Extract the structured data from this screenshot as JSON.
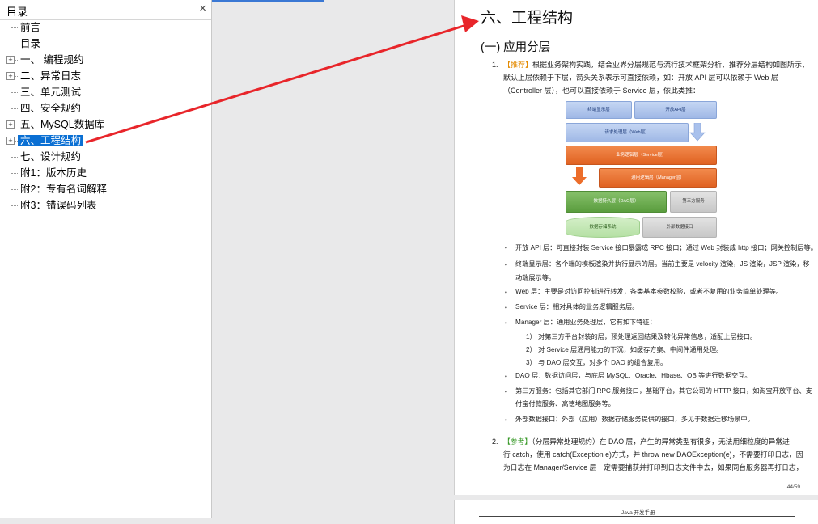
{
  "toc": {
    "title": "目录",
    "close": "×",
    "items": [
      {
        "label": "前言",
        "expandable": false,
        "selected": false
      },
      {
        "label": "目录",
        "expandable": false,
        "selected": false
      },
      {
        "label": "一、 编程规约",
        "expandable": true,
        "selected": false
      },
      {
        "label": "二、异常日志",
        "expandable": true,
        "selected": false
      },
      {
        "label": "三、单元测试",
        "expandable": false,
        "selected": false
      },
      {
        "label": "四、安全规约",
        "expandable": false,
        "selected": false
      },
      {
        "label": "五、MySQL数据库",
        "expandable": true,
        "selected": false
      },
      {
        "label": "六、工程结构",
        "expandable": true,
        "selected": true
      },
      {
        "label": "七、设计规约",
        "expandable": false,
        "selected": false
      },
      {
        "label": "附1：版本历史",
        "expandable": false,
        "selected": false
      },
      {
        "label": "附2：专有名词解释",
        "expandable": false,
        "selected": false
      },
      {
        "label": "附3：错误码列表",
        "expandable": false,
        "selected": false
      }
    ]
  },
  "doc": {
    "chapter_title": "六、工程结构",
    "section_title": "(一) 应用分层",
    "item1": {
      "num": "1.",
      "tag": "【推荐】",
      "line1": "根据业务架构实践，结合业界分层规范与流行技术框架分析，推荐分层结构如图所示，",
      "line2": "默认上层依赖于下层，箭头关系表示可直接依赖，如：开放 API 层可以依赖于 Web 层",
      "line3": "（Controller 层），也可以直接依赖于 Service 层，依此类推："
    },
    "diagram": {
      "terminal": "终端显示层",
      "open_api": "开放API层",
      "web": "请求处理层（Web层）",
      "service": "业务逻辑层（Service层）",
      "manager": "通用逻辑层（Manager层）",
      "dao": "数据持久层（DAO层）",
      "third_party": "第三方服务",
      "storage": "数据存储系统",
      "external": "外部数据接口"
    },
    "bullets": [
      "开放 API 层：可直接封装 Service 接口暴露成 RPC 接口；通过 Web 封装成 http 接口；网关控制层等。",
      "终端显示层：各个端的模板渲染并执行显示的层。当前主要是 velocity 渲染，JS 渲染，JSP 渲染，移",
      "动端展示等。",
      "Web 层：主要是对访问控制进行转发，各类基本参数校验，或者不复用的业务简单处理等。",
      "Service 层：相对具体的业务逻辑服务层。",
      "Manager 层：通用业务处理层，它有如下特征：",
      "1） 对第三方平台封装的层，预处理返回结果及转化异常信息，适配上层接口。",
      "2） 对 Service 层通用能力的下沉，如缓存方案、中间件通用处理。",
      "3） 与 DAO 层交互，对多个 DAO 的组合复用。",
      "DAO 层：数据访问层，与底层 MySQL、Oracle、Hbase、OB 等进行数据交互。",
      "第三方服务：包括其它部门 RPC 服务接口，基础平台，其它公司的 HTTP 接口，如淘宝开放平台、支",
      "付宝付款服务、高德地图服务等。",
      "外部数据接口：外部（应用）数据存储服务提供的接口，多见于数据迁移场景中。"
    ],
    "item2": {
      "num": "2.",
      "tag": "【参考】",
      "line1": "（分层异常处理规约）在 DAO 层，产生的异常类型有很多，无法用细粒度的异常进",
      "line2": "行 catch，使用 catch(Exception e)方式，并 throw new DAOException(e)，不需要打印日志，因",
      "line3": "为日志在 Manager/Service 层一定需要捕获并打印到日志文件中去，如果同台服务器再打日志，"
    },
    "page_number": "44/59",
    "next_page_header": "Java 开发手册"
  },
  "colors": {
    "accent": "#0a6fd3",
    "arrow": "#e8252a",
    "recommend": "#e38a00",
    "reference": "#3a9a2a"
  }
}
